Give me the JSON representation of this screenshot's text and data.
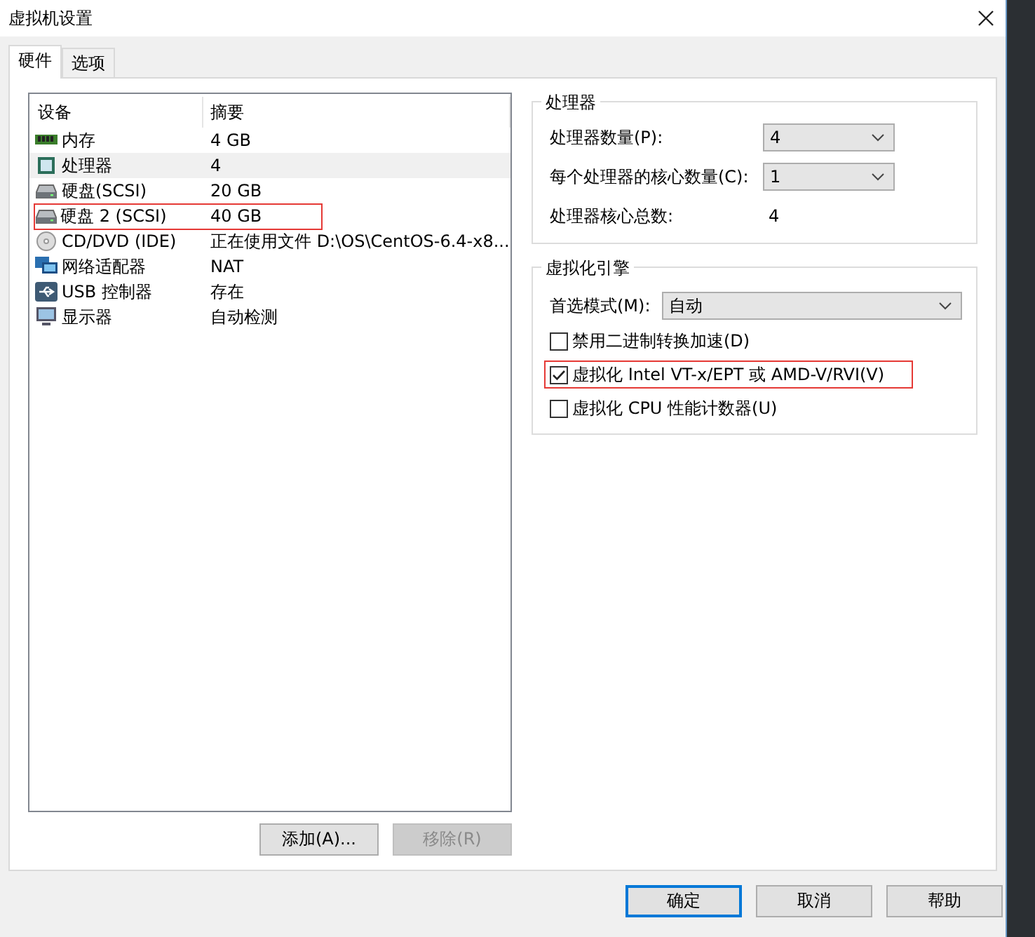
{
  "window": {
    "title": "虚拟机设置"
  },
  "tabs": [
    {
      "label": "硬件",
      "selected": true
    },
    {
      "label": "选项",
      "selected": false
    }
  ],
  "device_list": {
    "columns": [
      "设备",
      "摘要"
    ],
    "rows": [
      {
        "kind": "memory",
        "device": "内存",
        "summary": "4 GB",
        "selected": false,
        "highlighted": false
      },
      {
        "kind": "processor",
        "device": "处理器",
        "summary": "4",
        "selected": true,
        "highlighted": false
      },
      {
        "kind": "disk",
        "device": "硬盘(SCSI)",
        "summary": "20 GB",
        "selected": false,
        "highlighted": false
      },
      {
        "kind": "disk",
        "device": "硬盘 2 (SCSI)",
        "summary": "40 GB",
        "selected": false,
        "highlighted": true
      },
      {
        "kind": "cdrom",
        "device": "CD/DVD (IDE)",
        "summary": "正在使用文件 D:\\OS\\CentOS-6.4-x8...",
        "selected": false,
        "highlighted": false
      },
      {
        "kind": "network",
        "device": "网络适配器",
        "summary": "NAT",
        "selected": false,
        "highlighted": false
      },
      {
        "kind": "usb",
        "device": "USB 控制器",
        "summary": "存在",
        "selected": false,
        "highlighted": false
      },
      {
        "kind": "display",
        "device": "显示器",
        "summary": "自动检测",
        "selected": false,
        "highlighted": false
      }
    ]
  },
  "list_buttons": [
    {
      "label": "添加(A)...",
      "disabled": false
    },
    {
      "label": "移除(R)",
      "disabled": true
    }
  ],
  "processor_group": {
    "title": "处理器",
    "dropdowns": [
      {
        "label": "处理器数量(P):",
        "value": "4"
      },
      {
        "label": "每个处理器的核心数量(C):",
        "value": "1"
      }
    ],
    "total_label": "处理器核心总数:",
    "total_value": "4"
  },
  "virtualization_group": {
    "title": "虚拟化引擎",
    "mode": {
      "label": "首选模式(M):",
      "value": "自动"
    },
    "options": [
      {
        "label": "禁用二进制转换加速(D)",
        "checked": false,
        "highlighted": false
      },
      {
        "label": "虚拟化 Intel VT-x/EPT 或 AMD-V/RVI(V)",
        "checked": true,
        "highlighted": true
      },
      {
        "label": "虚拟化 CPU 性能计数器(U)",
        "checked": false,
        "highlighted": false
      }
    ]
  },
  "dialog_buttons": [
    {
      "label": "确定",
      "default": true
    },
    {
      "label": "取消",
      "default": false
    },
    {
      "label": "帮助",
      "default": false
    }
  ]
}
